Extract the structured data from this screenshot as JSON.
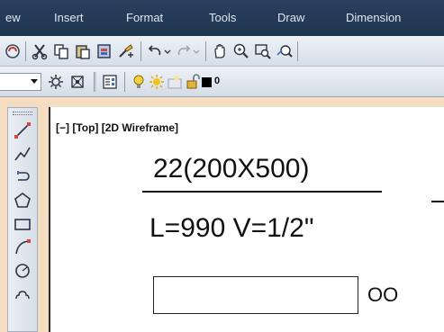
{
  "menubar": {
    "items": [
      "ew",
      "Insert",
      "Format",
      "Tools",
      "Draw",
      "Dimension"
    ]
  },
  "toolbar2": {
    "layer_name": "0"
  },
  "viewport": {
    "label": "[−] [Top] [2D Wireframe]"
  },
  "drawing": {
    "beam_mark": "22(200X500)",
    "beam_detail": "L=990 V=1/2\"",
    "circles_text": "OO"
  },
  "colors": {
    "menubar": "#29415f",
    "frame": "#f4ddc0",
    "canvas": "#ffffff"
  }
}
